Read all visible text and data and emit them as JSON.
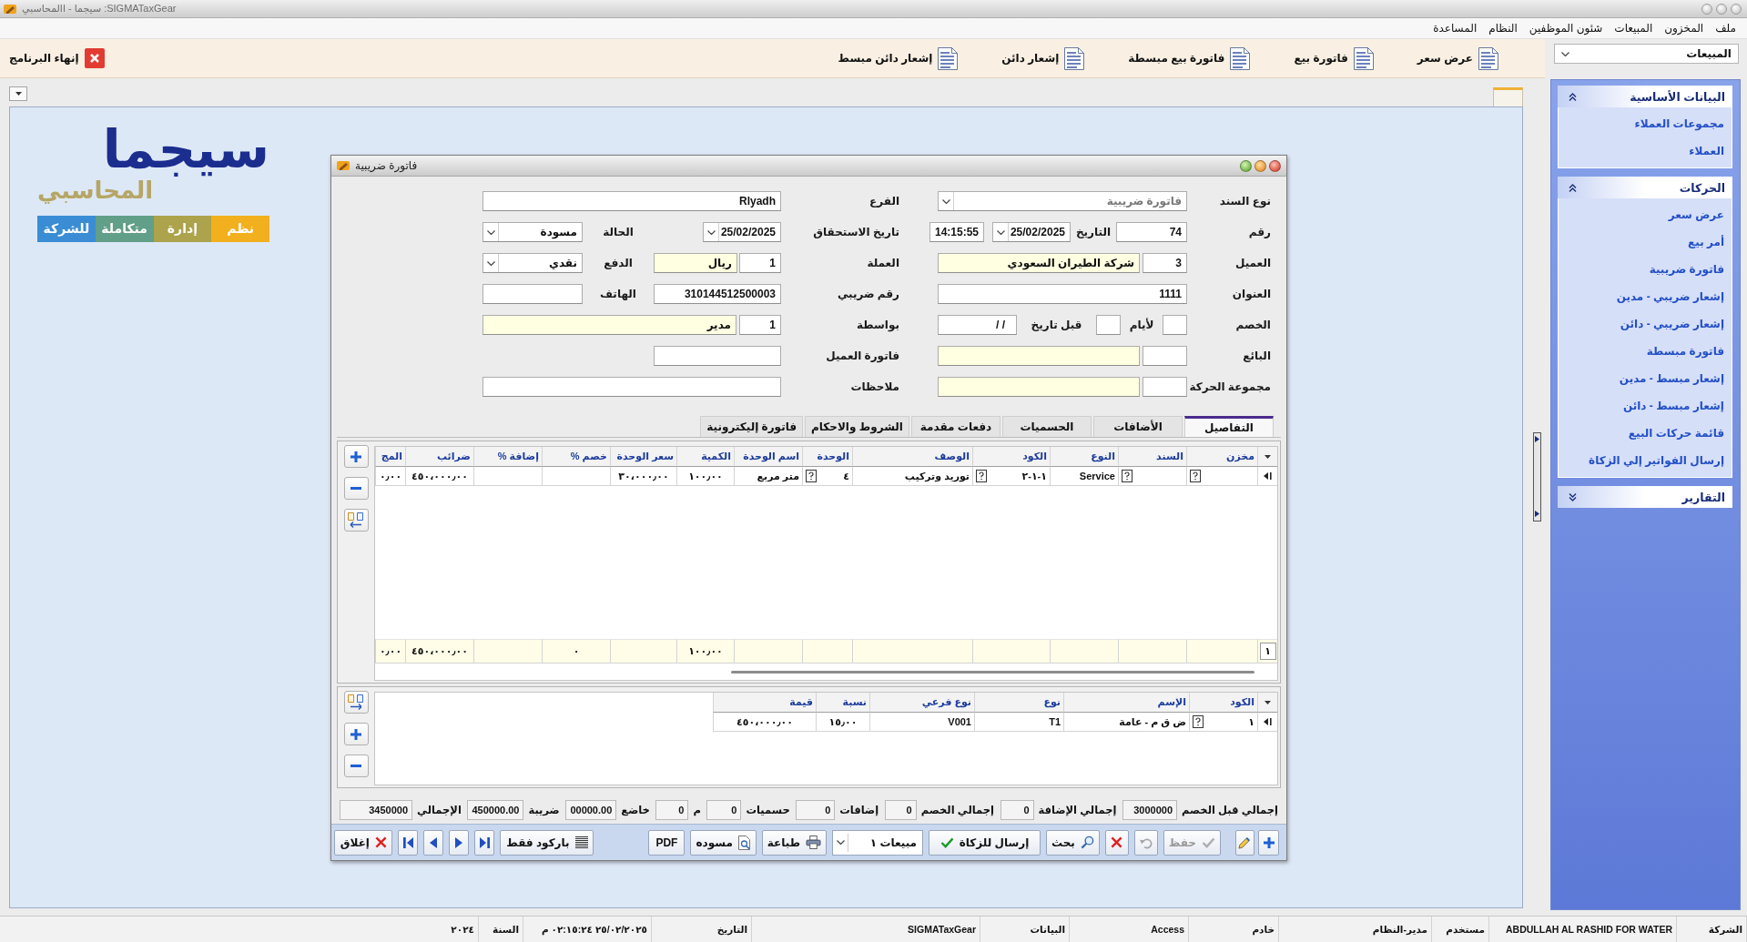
{
  "window": {
    "title": "سيجما - االمحاسبي :SIGMATaxGear"
  },
  "menu": [
    "ملف",
    "المخزون",
    "المبيعات",
    "شئون الموظفين",
    "النظام",
    "المساعدة"
  ],
  "toolbar": {
    "items": [
      "عرض سعر",
      "فاتورة بيع",
      "فاتورة بيع مبسطة",
      "إشعار دائن",
      "إشعار دائن مبسط"
    ],
    "exit": "إنهاء البرنامج"
  },
  "sidebar": {
    "module": "المبيعات",
    "groups": [
      {
        "title": "البيانات الأساسية",
        "expanded": true,
        "items": [
          "مجموعات العملاء",
          "العملاء"
        ]
      },
      {
        "title": "الحركات",
        "expanded": true,
        "items": [
          "عرض سعر",
          "أمر بيع",
          "فاتورة ضريبية",
          "إشعار ضريبي - مدين",
          "إشعار ضريبي - دائن",
          "فاتورة مبسطة",
          "إشعار مبسط - مدين",
          "إشعار مبسط - دائن",
          "قائمة حركات البيع",
          "إرسال الفواتير إلي الزكاة"
        ]
      },
      {
        "title": "التقارير",
        "expanded": false
      }
    ]
  },
  "logo": {
    "title": "سيجما",
    "subtitle": "المحاسبي",
    "tagline": [
      {
        "text": "نظم",
        "color": "#f2b01e"
      },
      {
        "text": "إدارة",
        "color": "#aca34c"
      },
      {
        "text": "متكاملة",
        "color": "#629f88"
      },
      {
        "text": "للشركة",
        "color": "#3a8dd4"
      }
    ]
  },
  "dialog": {
    "title": "فاتورة ضريبية",
    "form": {
      "document_type": {
        "label": "نوع السند",
        "value": "فاتورة ضريبية",
        "disabled": true
      },
      "number": {
        "label": "رقم",
        "value": "74"
      },
      "date": {
        "label": "التاريخ",
        "value": "25/02/2025",
        "time": "14:15:55"
      },
      "customer": {
        "label": "العميل",
        "code": "3",
        "name": "شركة الطيران السعودي"
      },
      "address": {
        "label": "العنوان",
        "value": "1111"
      },
      "discount": {
        "label": "الخصم",
        "days_label": "لأيام",
        "before_date_label": "قبل تاريخ",
        "before_date": "/ /"
      },
      "seller": {
        "label": "البائع"
      },
      "transaction_group": {
        "label": "مجموعة الحركة"
      },
      "branch": {
        "label": "الفرع",
        "value": "Rlyadh"
      },
      "due_date": {
        "label": "تاريخ الاستحقاق",
        "value": "25/02/2025"
      },
      "status": {
        "label": "الحالة",
        "value": "مسودة"
      },
      "currency": {
        "label": "العملة",
        "code": "1",
        "name": "ريال"
      },
      "payment": {
        "label": "الدفع",
        "value": "نقدي"
      },
      "tax_number": {
        "label": "رقم ضريبي",
        "value": "310144512500003"
      },
      "phone": {
        "label": "الهاتف"
      },
      "by": {
        "label": "بواسطة",
        "code": "1",
        "name": "مدير"
      },
      "customer_invoice": {
        "label": "فاتورة العميل"
      },
      "notes": {
        "label": "ملاحظات"
      }
    },
    "tabs": [
      {
        "label": "التفاصيل",
        "selected": true
      },
      {
        "label": "الأضافات",
        "selected": false
      },
      {
        "label": "الحسميات",
        "selected": false
      },
      {
        "label": "دفعات مقدمة",
        "selected": false
      },
      {
        "label": "الشروط والاحكام",
        "selected": false
      },
      {
        "label": "فاتورة إليكترونية",
        "selected": false
      }
    ],
    "items_grid": {
      "columns": [
        "مخزن",
        "السند",
        "النوع",
        "الكود",
        "الوصف",
        "الوحدة",
        "اسم الوحدة",
        "الكمية",
        "سعر الوحدة",
        "خصم %",
        "إضافة %",
        "ضرائب",
        "المج"
      ],
      "rows": [
        {
          "type": "Service",
          "code": "١-١-٢",
          "description": "توريد وتركيب",
          "unit": "٤",
          "unit_name": "متر مربع",
          "quantity": "١٠٠٫٠٠",
          "unit_price": "٣٠،٠٠٠٫٠٠",
          "taxes": "٤٥٠،٠٠٠٫٠٠",
          "column_13": "٠٫٠٠"
        }
      ],
      "totals": {
        "count": "١",
        "quantity": "١٠٠٫٠٠",
        "discount": "٠",
        "taxes": "٤٥٠،٠٠٠٫٠٠",
        "column_13": "٠٫٠٠"
      }
    },
    "tax_grid": {
      "columns": [
        "الكود",
        "الإسم",
        "نوع",
        "نوع فرعي",
        "نسبة",
        "قيمة"
      ],
      "rows": [
        {
          "code": "١",
          "name": "ض ق م - عامة",
          "type": "T1",
          "subtype": "V001",
          "rate": "١٥٫٠٠",
          "amount": "٤٥٠،٠٠٠٫٠٠"
        }
      ]
    },
    "totals": [
      {
        "label": "إجمالي قبل الخصم",
        "value": "3000000"
      },
      {
        "label": "إجمالي الإضافة",
        "value": "0"
      },
      {
        "label": "إجمالي الخصم",
        "value": "0"
      },
      {
        "label": "إضافات",
        "value": "0"
      },
      {
        "label": "حسميات",
        "value": "0"
      },
      {
        "label": "م",
        "value": "0"
      },
      {
        "label": "خاضع",
        "value": "00000.00"
      },
      {
        "label": "ضريبة",
        "value": "450000.00"
      },
      {
        "label": "الإجمالي",
        "value": "3450000"
      }
    ],
    "actions": [
      {
        "kind": "add",
        "disabled": false
      },
      {
        "kind": "edit",
        "disabled": false
      },
      {
        "kind": "save",
        "label": "حفظ",
        "disabled": true
      },
      {
        "kind": "undo",
        "disabled": true
      },
      {
        "kind": "cancel",
        "disabled": false
      },
      {
        "kind": "search",
        "label": "بحث",
        "disabled": false
      },
      {
        "kind": "send",
        "label": "إرسال للزكاة",
        "disabled": false
      },
      {
        "kind": "select",
        "label": "مبيعات ١",
        "disabled": false
      },
      {
        "kind": "print",
        "label": "طباعة",
        "disabled": false
      },
      {
        "kind": "preview",
        "label": "مسوده",
        "disabled": false
      },
      {
        "kind": "pdf",
        "label": "PDF",
        "disabled": false
      },
      {
        "kind": "barcode",
        "label": "باركود فقط",
        "disabled": false
      },
      {
        "kind": "last",
        "disabled": false
      },
      {
        "kind": "next",
        "disabled": false
      },
      {
        "kind": "previous",
        "disabled": false
      },
      {
        "kind": "first",
        "disabled": false
      },
      {
        "kind": "close",
        "label": "إغلاق",
        "disabled": false
      }
    ]
  },
  "status_bar": [
    "الشركة",
    "ABDULLAH AL RASHID FOR WATER",
    "مستخدم",
    "مدير-النظام",
    "خادم",
    "Access",
    "البيانات",
    "SIGMATaxGear",
    "التاريخ",
    "٢٥/٠٢/٢٠٢٥ ٠٢:١٥:٢٤ م",
    "السنة",
    "٢٠٢٤"
  ]
}
